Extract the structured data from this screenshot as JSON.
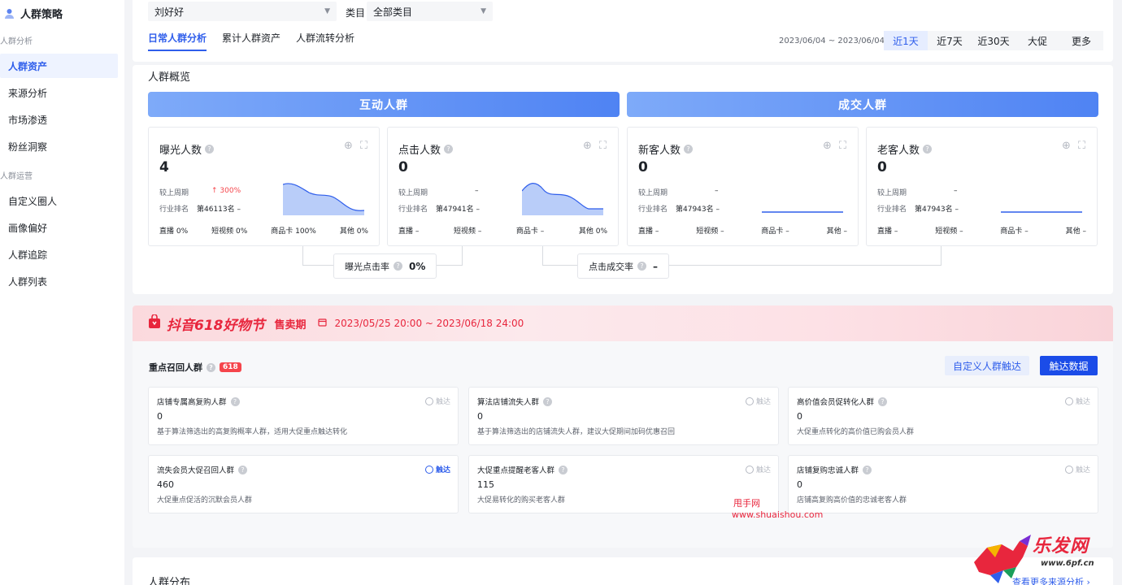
{
  "sidebar": {
    "title": "人群策略",
    "groups": [
      {
        "label": "人群分析",
        "items": [
          "人群资产",
          "来源分析",
          "市场渗透",
          "粉丝洞察"
        ]
      },
      {
        "label": "人群运营",
        "items": [
          "自定义圈人",
          "画像偏好",
          "人群追踪",
          "人群列表"
        ]
      }
    ],
    "active_item": "人群资产"
  },
  "filters": {
    "account_value": "刘好好",
    "category_label": "类目",
    "category_value": "全部类目"
  },
  "tabs": [
    "日常人群分析",
    "累计人群资产",
    "人群流转分析"
  ],
  "date_range": "2023/06/04 ~ 2023/06/04",
  "periods": [
    "近1天",
    "近7天",
    "近30天",
    "大促",
    "更多"
  ],
  "overview": {
    "title": "人群概览",
    "banners": [
      "互动人群",
      "成交人群"
    ],
    "cards": [
      {
        "title": "曝光人数",
        "value": "4",
        "prev_label": "较上周期",
        "prev_value": "↑ 300%",
        "rank_label": "行业排名",
        "rank_value": "第46113名 –",
        "foot": [
          "直播 0%",
          "短视频 0%",
          "商品卡 100%",
          "其他 0%"
        ]
      },
      {
        "title": "点击人数",
        "value": "0",
        "prev_label": "较上周期",
        "prev_value": "–",
        "rank_label": "行业排名",
        "rank_value": "第47941名 –",
        "foot": [
          "直播 –",
          "短视频 –",
          "商品卡 –",
          "其他 0%"
        ]
      },
      {
        "title": "新客人数",
        "value": "0",
        "prev_label": "较上周期",
        "prev_value": "–",
        "rank_label": "行业排名",
        "rank_value": "第47943名 –",
        "foot": [
          "直播 –",
          "短视频 –",
          "商品卡 –",
          "其他 –"
        ]
      },
      {
        "title": "老客人数",
        "value": "0",
        "prev_label": "较上周期",
        "prev_value": "–",
        "rank_label": "行业排名",
        "rank_value": "第47943名 –",
        "foot": [
          "直播 –",
          "短视频 –",
          "商品卡 –",
          "其他 –"
        ]
      }
    ],
    "rates": [
      {
        "label": "曝光点击率",
        "value": "0%"
      },
      {
        "label": "点击成交率",
        "value": "–"
      }
    ]
  },
  "promo": {
    "logo_text": "抖音618好物节",
    "phase": "售卖期",
    "dates": "2023/05/25 20:00 ~ 2023/06/18 24:00",
    "section_title": "重点召回人群",
    "badge": "618",
    "btn_custom": "自定义人群触达",
    "btn_data": "触达数据",
    "reach_label": "触达",
    "groups": [
      {
        "title": "店铺专属高复购人群",
        "value": "0",
        "desc": "基于算法筛选出的高复购概率人群，适用大促重点触达转化",
        "active": false
      },
      {
        "title": "算法店铺流失人群",
        "value": "0",
        "desc": "基于算法筛选出的店铺流失人群，建议大促期间加码优惠召回",
        "active": false
      },
      {
        "title": "高价值会员促转化人群",
        "value": "0",
        "desc": "大促重点转化的高价值已购会员人群",
        "active": false
      },
      {
        "title": "流失会员大促召回人群",
        "value": "460",
        "desc": "大促重点促活的沉默会员人群",
        "active": true
      },
      {
        "title": "大促重点提醒老客人群",
        "value": "115",
        "desc": "大促易转化的购买老客人群",
        "active": false
      },
      {
        "title": "店铺复购忠诚人群",
        "value": "0",
        "desc": "店铺高复购高价值的忠诚老客人群",
        "active": false
      }
    ]
  },
  "watermark": {
    "name": "甩手网",
    "url": "www.shuaishou.com"
  },
  "distribution": {
    "title": "人群分布",
    "more": "查看更多来源分析 ›"
  },
  "corner": {
    "brand": "乐发网",
    "url": "www.6pf.cn"
  },
  "colors": {
    "accent": "#2f5eeb",
    "primary_btn": "#1b4ce8",
    "promo_red": "#e8263d",
    "up": "#f5454b"
  }
}
